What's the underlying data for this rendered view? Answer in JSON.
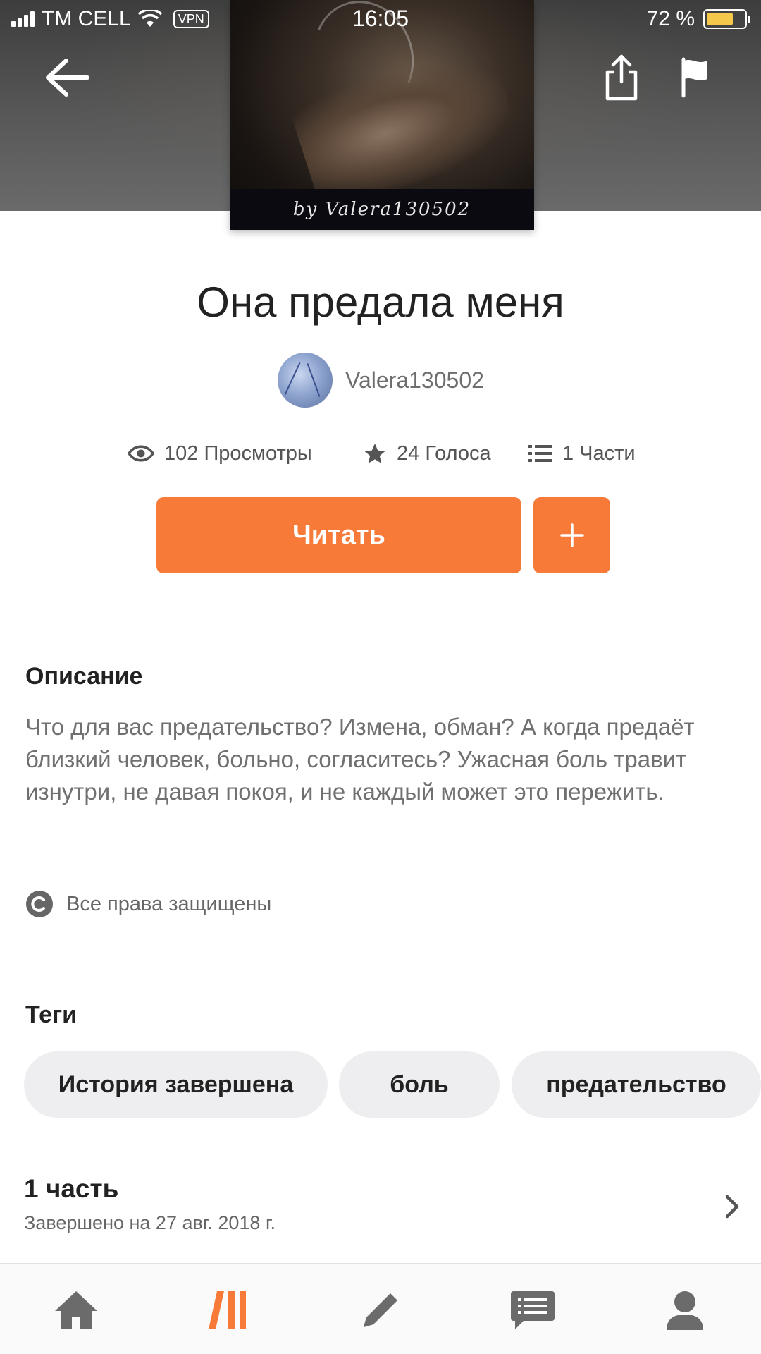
{
  "status_bar": {
    "carrier": "TM CELL",
    "vpn": "VPN",
    "time": "16:05",
    "battery": "72 %",
    "battery_level": 0.72
  },
  "header": {
    "cover_byline": "by Valera130502"
  },
  "story": {
    "title": "Она предала меня",
    "author": "Valera130502",
    "stats": {
      "views": "102 Просмотры",
      "votes": "24 Голоса",
      "parts": "1 Части"
    },
    "read_label": "Читать",
    "add_label": "+"
  },
  "description": {
    "heading": "Описание",
    "text": "Что для вас предательство? Измена, обман? А когда предаёт близкий человек, больно, согласитесь? Ужасная боль травит изнутри, не давая покоя, и не каждый может это пережить."
  },
  "rights": {
    "text": "Все права защищены"
  },
  "tags": {
    "heading": "Теги",
    "items": [
      "История завершена",
      "боль",
      "предательство"
    ]
  },
  "parts": {
    "title": "1 часть",
    "subtitle": "Завершено на 27 авг. 2018 г."
  },
  "colors": {
    "accent": "#f77a39",
    "tag_bg": "#eeeef0",
    "nav_icon": "#6b6b6b"
  },
  "nav": {
    "items": [
      "home-icon",
      "library-icon",
      "write-icon",
      "messages-icon",
      "profile-icon"
    ],
    "active": "library-icon"
  }
}
